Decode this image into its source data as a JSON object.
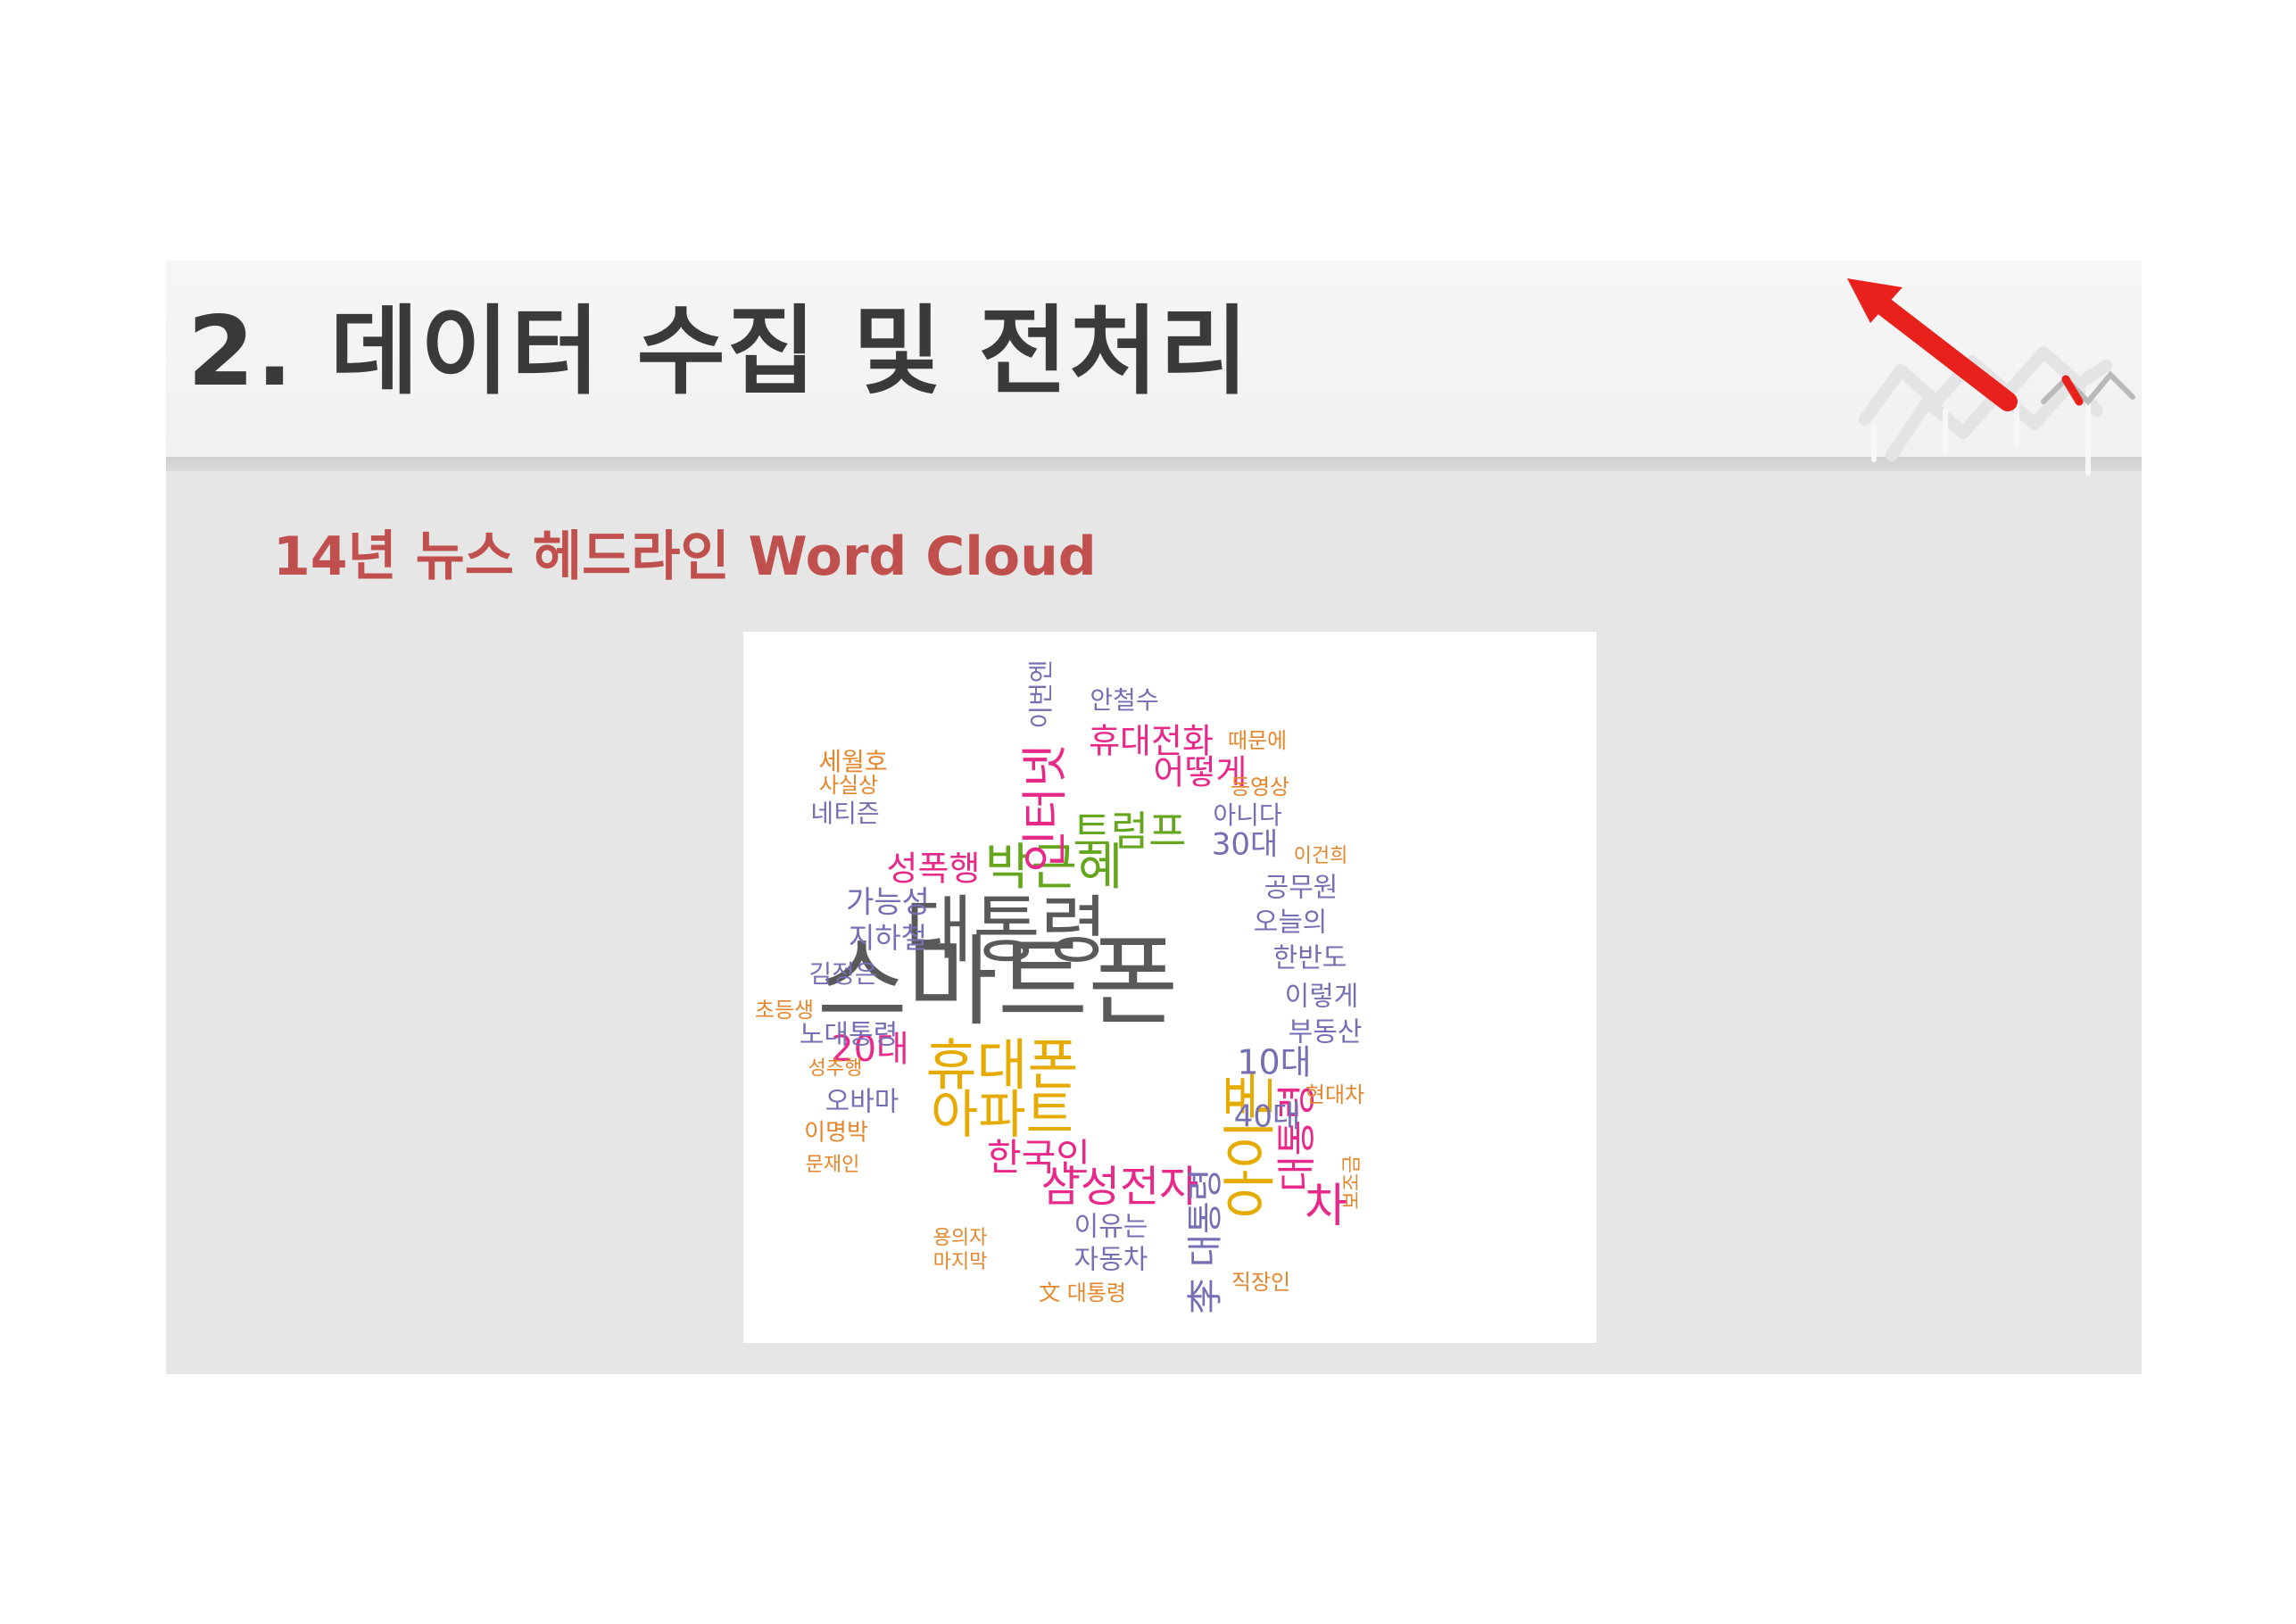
{
  "slide": {
    "title": "2. 데이터 수집 및 전처리",
    "subtitle": "14년 뉴스 헤드라인 Word Cloud"
  },
  "colors": {
    "header_band": "#f3f3f3",
    "body_band": "#e6e6e6",
    "title_text": "#3a3a3a",
    "subtitle_text": "#c0504d",
    "arrow_red": "#e8211d",
    "palette": {
      "gray": "#595959",
      "orange": "#e5862b",
      "pink": "#e7298a",
      "green": "#66a61e",
      "gold": "#e6ab02",
      "lavender": "#7570b3",
      "brown": "#a6761d"
    }
  },
  "word_cloud": {
    "words": [
      {
        "text": "스마트폰",
        "color": "gray"
      },
      {
        "text": "대통령",
        "color": "gray"
      },
      {
        "text": "휴대폰",
        "color": "gold"
      },
      {
        "text": "아파트",
        "color": "gold"
      },
      {
        "text": "아이폰",
        "color": "gold"
      },
      {
        "text": "박근혜",
        "color": "green"
      },
      {
        "text": "트럼프",
        "color": "green"
      },
      {
        "text": "인터넷",
        "color": "pink"
      },
      {
        "text": "삼성전자",
        "color": "pink"
      },
      {
        "text": "한국인",
        "color": "pink"
      },
      {
        "text": "휴대전화",
        "color": "pink"
      },
      {
        "text": "어떻게",
        "color": "pink"
      },
      {
        "text": "성폭행",
        "color": "pink"
      },
      {
        "text": "20대",
        "color": "pink"
      },
      {
        "text": "차",
        "color": "pink"
      },
      {
        "text": "대통령",
        "color": "pink"
      },
      {
        "text": "李 대통령",
        "color": "lavender"
      },
      {
        "text": "10대",
        "color": "lavender"
      },
      {
        "text": "40대",
        "color": "lavender"
      },
      {
        "text": "30대",
        "color": "lavender"
      },
      {
        "text": "가능성",
        "color": "lavender"
      },
      {
        "text": "지하철",
        "color": "lavender"
      },
      {
        "text": "이유는",
        "color": "lavender"
      },
      {
        "text": "자동차",
        "color": "lavender"
      },
      {
        "text": "오바마",
        "color": "lavender"
      },
      {
        "text": "노대통령",
        "color": "lavender"
      },
      {
        "text": "김정은",
        "color": "lavender"
      },
      {
        "text": "네티즌",
        "color": "lavender"
      },
      {
        "text": "안철수",
        "color": "lavender"
      },
      {
        "text": "이번엔",
        "color": "lavender"
      },
      {
        "text": "아니다",
        "color": "lavender"
      },
      {
        "text": "공무원",
        "color": "lavender"
      },
      {
        "text": "오늘의",
        "color": "lavender"
      },
      {
        "text": "한반도",
        "color": "lavender"
      },
      {
        "text": "이렇게",
        "color": "lavender"
      },
      {
        "text": "부동산",
        "color": "lavender"
      },
      {
        "text": "세월호",
        "color": "orange"
      },
      {
        "text": "사실상",
        "color": "orange"
      },
      {
        "text": "때문에",
        "color": "orange"
      },
      {
        "text": "동영상",
        "color": "orange"
      },
      {
        "text": "이건희",
        "color": "orange"
      },
      {
        "text": "현대차",
        "color": "orange"
      },
      {
        "text": "보조금",
        "color": "orange"
      },
      {
        "text": "초등생",
        "color": "orange"
      },
      {
        "text": "성추행",
        "color": "orange"
      },
      {
        "text": "이명박",
        "color": "orange"
      },
      {
        "text": "문재인",
        "color": "orange"
      },
      {
        "text": "용의자",
        "color": "orange"
      },
      {
        "text": "마지막",
        "color": "orange"
      },
      {
        "text": "文 대통령",
        "color": "orange"
      },
      {
        "text": "직장인",
        "color": "orange"
      }
    ]
  }
}
